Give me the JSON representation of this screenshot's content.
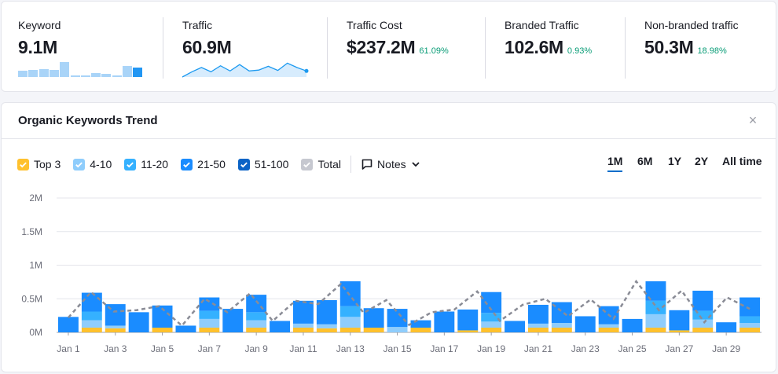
{
  "metrics": [
    {
      "label": "Keyword",
      "value": "9.1M",
      "pct": ""
    },
    {
      "label": "Traffic",
      "value": "60.9M",
      "pct": ""
    },
    {
      "label": "Traffic Cost",
      "value": "$237.2M",
      "pct": "61.09%"
    },
    {
      "label": "Branded Traffic",
      "value": "102.6M",
      "pct": "0.93%"
    },
    {
      "label": "Non-branded traffic",
      "value": "50.3M",
      "pct": "18.98%"
    }
  ],
  "keyword_spark": [
    0.42,
    0.47,
    0.52,
    0.45,
    0.95,
    0.1,
    0.12,
    0.25,
    0.18,
    0.12,
    0.72,
    0.62
  ],
  "traffic_spark": [
    0.0,
    0.3,
    0.55,
    0.3,
    0.65,
    0.35,
    0.72,
    0.35,
    0.4,
    0.62,
    0.38,
    0.8,
    0.55,
    0.35
  ],
  "trend": {
    "title": "Organic Keywords Trend",
    "close_label": "×",
    "legend": [
      {
        "label": "Top 3",
        "color": "#ffc12d"
      },
      {
        "label": "4-10",
        "color": "#8fcdfc"
      },
      {
        "label": "11-20",
        "color": "#35b1ff"
      },
      {
        "label": "21-50",
        "color": "#1a8cff"
      },
      {
        "label": "51-100",
        "color": "#0b63c6"
      },
      {
        "label": "Total",
        "color": "#c6c8d0"
      }
    ],
    "notes_label": "Notes",
    "ranges": [
      "1M",
      "6M",
      "1Y",
      "2Y",
      "All time"
    ],
    "active_range": "1M"
  },
  "chart_data": {
    "type": "bar",
    "stacked": true,
    "ylim": [
      0,
      2000000
    ],
    "yticks": [
      "0M",
      "0.5M",
      "1M",
      "1.5M",
      "2M"
    ],
    "x_tick_labels": [
      "Jan 1",
      "Jan 3",
      "Jan 5",
      "Jan 7",
      "Jan 9",
      "Jan 11",
      "Jan 13",
      "Jan 15",
      "Jan 17",
      "Jan 19",
      "Jan 21",
      "Jan 23",
      "Jan 25",
      "Jan 27",
      "Jan 29"
    ],
    "days": 30,
    "series": [
      {
        "name": "Top 3",
        "values": [
          0,
          70000,
          60000,
          0,
          70000,
          0,
          70000,
          0,
          70000,
          0,
          70000,
          60000,
          70000,
          70000,
          0,
          70000,
          0,
          30000,
          70000,
          0,
          70000,
          70000,
          0,
          70000,
          0,
          70000,
          30000,
          70000,
          0,
          70000
        ]
      },
      {
        "name": "4-10",
        "values": [
          0,
          110000,
          40000,
          0,
          0,
          0,
          130000,
          0,
          110000,
          0,
          60000,
          60000,
          160000,
          0,
          80000,
          0,
          0,
          0,
          90000,
          0,
          60000,
          70000,
          0,
          50000,
          0,
          200000,
          0,
          120000,
          0,
          70000
        ]
      },
      {
        "name": "11-20",
        "values": [
          0,
          130000,
          0,
          0,
          0,
          0,
          120000,
          0,
          120000,
          0,
          0,
          0,
          160000,
          0,
          0,
          0,
          0,
          0,
          130000,
          0,
          0,
          0,
          0,
          0,
          0,
          200000,
          0,
          130000,
          0,
          100000
        ]
      },
      {
        "name": "21-50",
        "values": [
          230000,
          280000,
          320000,
          300000,
          330000,
          100000,
          200000,
          350000,
          260000,
          170000,
          340000,
          360000,
          370000,
          290000,
          270000,
          110000,
          310000,
          310000,
          310000,
          170000,
          280000,
          310000,
          240000,
          270000,
          200000,
          290000,
          300000,
          300000,
          150000,
          280000
        ]
      },
      {
        "name": "51-100",
        "values": [
          0,
          0,
          0,
          0,
          0,
          0,
          0,
          0,
          0,
          0,
          0,
          0,
          0,
          0,
          0,
          0,
          0,
          0,
          0,
          0,
          0,
          0,
          0,
          0,
          0,
          0,
          0,
          0,
          0,
          0
        ]
      },
      {
        "name": "Total",
        "values": [
          220000,
          600000,
          310000,
          330000,
          390000,
          100000,
          500000,
          300000,
          580000,
          170000,
          470000,
          420000,
          720000,
          290000,
          480000,
          110000,
          300000,
          340000,
          610000,
          170000,
          410000,
          500000,
          240000,
          490000,
          200000,
          760000,
          330000,
          620000,
          150000,
          520000,
          350000
        ]
      }
    ]
  }
}
